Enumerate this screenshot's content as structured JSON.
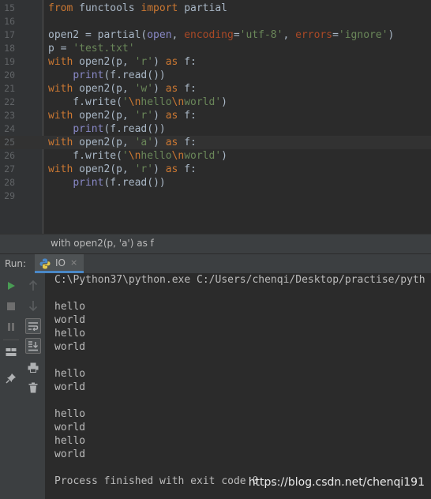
{
  "editor": {
    "lines": [
      {
        "num": "15",
        "tokens": [
          [
            "kw",
            "from"
          ],
          [
            "t",
            " functools "
          ],
          [
            "kw",
            "import"
          ],
          [
            "t",
            " partial"
          ]
        ]
      },
      {
        "num": "16",
        "tokens": []
      },
      {
        "num": "17",
        "tokens": [
          [
            "t",
            "open2 = partial("
          ],
          [
            "bi",
            "open"
          ],
          [
            "t",
            ", "
          ],
          [
            "param",
            "encoding"
          ],
          [
            "t",
            "="
          ],
          [
            "str",
            "'utf-8'"
          ],
          [
            "t",
            ", "
          ],
          [
            "param",
            "errors"
          ],
          [
            "t",
            "="
          ],
          [
            "str",
            "'ignore'"
          ],
          [
            "t",
            ")"
          ]
        ]
      },
      {
        "num": "18",
        "tokens": [
          [
            "t",
            "p = "
          ],
          [
            "str",
            "'test.txt'"
          ]
        ]
      },
      {
        "num": "19",
        "tokens": [
          [
            "kw",
            "with"
          ],
          [
            "t",
            " open2(p, "
          ],
          [
            "str",
            "'r'"
          ],
          [
            "t",
            ") "
          ],
          [
            "kw",
            "as"
          ],
          [
            "t",
            " f:"
          ]
        ]
      },
      {
        "num": "20",
        "tokens": [
          [
            "t",
            "    "
          ],
          [
            "bi",
            "print"
          ],
          [
            "t",
            "(f.read())"
          ]
        ]
      },
      {
        "num": "21",
        "tokens": [
          [
            "kw",
            "with"
          ],
          [
            "t",
            " open2(p, "
          ],
          [
            "str",
            "'w'"
          ],
          [
            "t",
            ") "
          ],
          [
            "kw",
            "as"
          ],
          [
            "t",
            " f:"
          ]
        ]
      },
      {
        "num": "22",
        "tokens": [
          [
            "t",
            "    f.write("
          ],
          [
            "str",
            "'"
          ],
          [
            "esc",
            "\\n"
          ],
          [
            "str",
            "hello"
          ],
          [
            "esc",
            "\\n"
          ],
          [
            "str",
            "world'"
          ],
          [
            "t",
            ")"
          ]
        ]
      },
      {
        "num": "23",
        "tokens": [
          [
            "kw",
            "with"
          ],
          [
            "t",
            " open2(p, "
          ],
          [
            "str",
            "'r'"
          ],
          [
            "t",
            ") "
          ],
          [
            "kw",
            "as"
          ],
          [
            "t",
            " f:"
          ]
        ]
      },
      {
        "num": "24",
        "tokens": [
          [
            "t",
            "    "
          ],
          [
            "bi",
            "print"
          ],
          [
            "t",
            "(f.read())"
          ]
        ]
      },
      {
        "num": "25",
        "tokens": [
          [
            "kw",
            "with"
          ],
          [
            "t",
            " open2(p, "
          ],
          [
            "str",
            "'a'"
          ],
          [
            "t",
            ") "
          ],
          [
            "kw",
            "as"
          ],
          [
            "t",
            " f:"
          ]
        ],
        "current": true
      },
      {
        "num": "26",
        "tokens": [
          [
            "t",
            "    f.write("
          ],
          [
            "str",
            "'"
          ],
          [
            "esc",
            "\\n"
          ],
          [
            "str",
            "hello"
          ],
          [
            "esc",
            "\\n"
          ],
          [
            "str",
            "world'"
          ],
          [
            "t",
            ")"
          ]
        ]
      },
      {
        "num": "27",
        "tokens": [
          [
            "kw",
            "with"
          ],
          [
            "t",
            " open2(p, "
          ],
          [
            "str",
            "'r'"
          ],
          [
            "t",
            ") "
          ],
          [
            "kw",
            "as"
          ],
          [
            "t",
            " f:"
          ]
        ]
      },
      {
        "num": "28",
        "tokens": [
          [
            "t",
            "    "
          ],
          [
            "bi",
            "print"
          ],
          [
            "t",
            "(f.read())"
          ]
        ]
      },
      {
        "num": "29",
        "tokens": []
      }
    ]
  },
  "breadcrumb": {
    "text": "with open2(p, 'a') as f"
  },
  "run_panel": {
    "label": "Run:",
    "tab_name": "IO",
    "tab_close": "×",
    "toolbar_left": [
      "run-icon",
      "stop-icon",
      "pause-icon",
      "layout-icon",
      "pin-icon"
    ],
    "toolbar_right": [
      "up-arrow-icon",
      "down-arrow-icon",
      "soft-wrap-icon",
      "scroll-to-end-icon",
      "print-icon",
      "trash-icon"
    ],
    "run_color": "#499c54"
  },
  "console": {
    "lines": [
      "C:\\Python37\\python.exe C:/Users/chenqi/Desktop/practise/pyth",
      "",
      "hello",
      "world",
      "hello",
      "world",
      "",
      "hello",
      "world",
      "",
      "hello",
      "world",
      "hello",
      "world",
      "",
      "Process finished with exit code 0"
    ]
  },
  "watermark": "https://blog.csdn.net/chenqi191"
}
